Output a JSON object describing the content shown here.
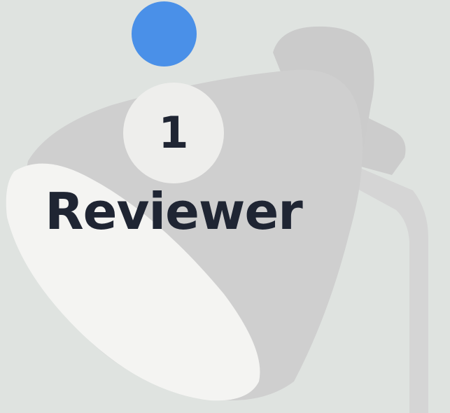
{
  "icons": {
    "background": "desk-lamp-icon"
  },
  "colors": {
    "background": "#dfe3e0",
    "status_dot": "#4a90e8",
    "badge": "#eeeeec",
    "text": "#1f2533",
    "lamp": "#cfcfcf"
  },
  "reviewer": {
    "count": "1",
    "label": "Reviewer"
  }
}
